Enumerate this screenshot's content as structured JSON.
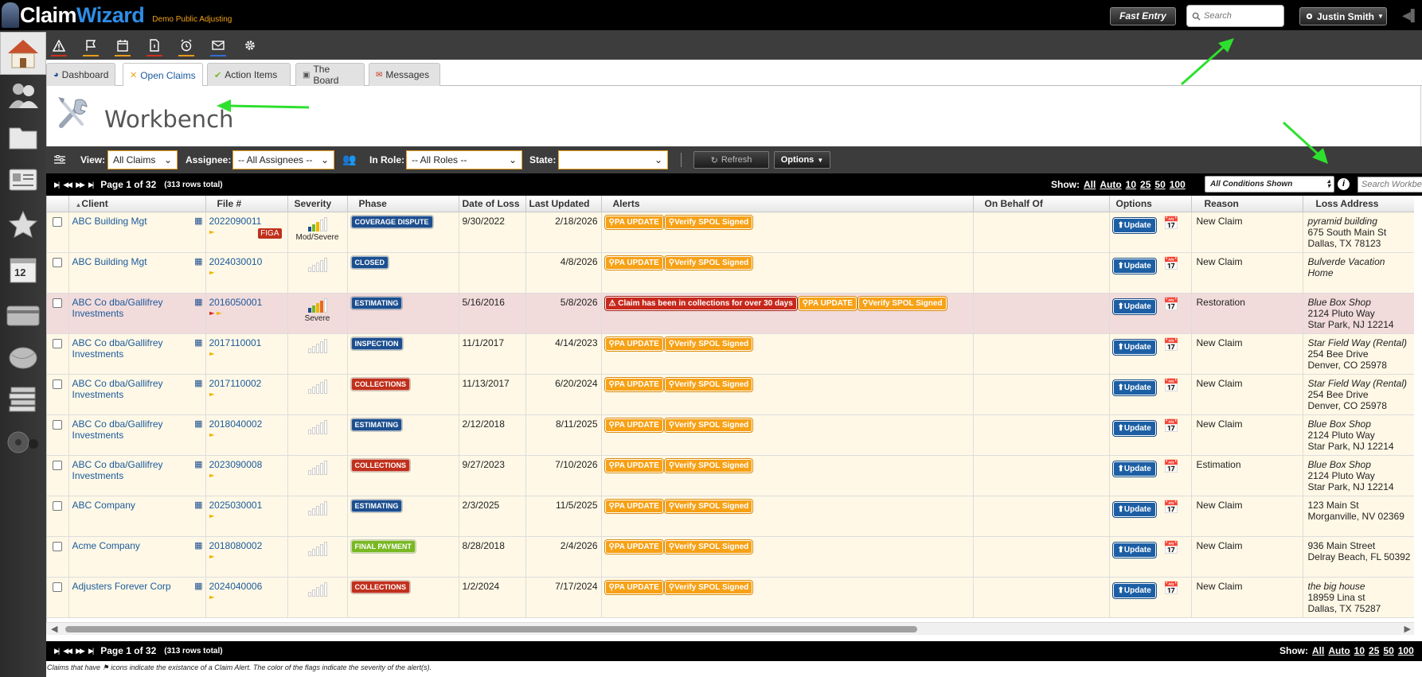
{
  "app": {
    "brand_part1": "Claim",
    "brand_part2": "Wizard",
    "company": "Demo Public Adjusting"
  },
  "header": {
    "fast_entry": "Fast Entry",
    "search_placeholder": "Search",
    "user": "Justin Smith"
  },
  "toolbar_icons": [
    "alert-triangle-icon",
    "flag-icon",
    "calendar-icon",
    "document-icon",
    "alarm-clock-icon",
    "mail-icon",
    "gear-icon"
  ],
  "tabs": [
    {
      "label": "Dashboard",
      "icon": "dashboard-icon"
    },
    {
      "label": "Open Claims",
      "icon": "tools-icon",
      "active": true
    },
    {
      "label": "Action Items",
      "icon": "checkmark-icon"
    },
    {
      "label": "The Board",
      "icon": "board-icon"
    },
    {
      "label": "Messages",
      "icon": "envelope-icon"
    }
  ],
  "page_title": "Workbench",
  "filters": {
    "view_label": "View:",
    "view_value": "All Claims",
    "assignee_label": "Assignee:",
    "assignee_value": "-- All Assignees --",
    "role_label": "In Role:",
    "role_value": "-- All Roles --",
    "state_label": "State:",
    "state_value": "",
    "refresh": "Refresh",
    "options": "Options"
  },
  "pager": {
    "page_text": "Page 1 of 32",
    "rows_text": "(313 rows total)",
    "show_label": "Show:",
    "show_options": [
      "All",
      "Auto",
      "10",
      "25",
      "50",
      "100"
    ],
    "conditions": "All Conditions Shown",
    "search_placeholder": "Search Workbench"
  },
  "columns": {
    "client": "Client",
    "file": "File #",
    "severity": "Severity",
    "phase": "Phase",
    "date_of_loss": "Date of Loss",
    "last_updated": "Last Updated",
    "alerts": "Alerts",
    "on_behalf_of": "On Behalf Of",
    "options": "Options",
    "reason": "Reason",
    "loss_address": "Loss Address"
  },
  "rows": [
    {
      "client": "ABC Building Mgt",
      "file": "2022090011",
      "figa": "FIGA",
      "severity_level": 3,
      "severity_label": "Mod/Severe",
      "phase": "COVERAGE DISPUTE",
      "phase_color": "blue",
      "dol": "9/30/2022",
      "updated": "2/18/2026",
      "alerts": [
        "PA UPDATE",
        "Verify SPOL Signed"
      ],
      "update": "Update",
      "reason": "New Claim",
      "addr": [
        "pyramid building",
        "675 South Main St",
        "Dallas, TX 78123"
      ],
      "flags": [
        "#f0b400"
      ]
    },
    {
      "client": "ABC Building Mgt",
      "file": "2024030010",
      "severity_level": 0,
      "severity_label": "",
      "phase": "CLOSED",
      "phase_color": "blue",
      "dol": "",
      "updated": "4/8/2026",
      "alerts": [
        "PA UPDATE",
        "Verify SPOL Signed"
      ],
      "update": "Update",
      "reason": "New Claim",
      "addr": [
        "Bulverde Vacation Home"
      ],
      "flags": [
        "#f0b400"
      ]
    },
    {
      "client": "ABC Co dba/Gallifrey Investments",
      "file": "2016050001",
      "severity_level": 4,
      "severity_label": "Severe",
      "phase": "ESTIMATING",
      "phase_color": "blue",
      "dol": "5/16/2016",
      "updated": "5/8/2026",
      "alert_red": "Claim has been in collections for over 30 days",
      "alerts": [
        "PA UPDATE",
        "Verify SPOL Signed"
      ],
      "update": "Update",
      "reason": "Restoration",
      "addr": [
        "Blue Box Shop",
        "2124 Pluto Way",
        "Star Park, NJ 12214"
      ],
      "flags": [
        "#d0301c",
        "#f0b400"
      ],
      "highlight": true
    },
    {
      "client": "ABC Co dba/Gallifrey Investments",
      "file": "2017110001",
      "severity_level": 0,
      "severity_label": "",
      "phase": "INSPECTION",
      "phase_color": "blue",
      "dol": "11/1/2017",
      "updated": "4/14/2023",
      "alerts": [
        "PA UPDATE",
        "Verify SPOL Signed"
      ],
      "update": "Update",
      "reason": "New Claim",
      "addr": [
        "Star Field Way (Rental)",
        "254 Bee Drive",
        "Denver, CO 25978"
      ],
      "flags": [
        "#f0b400"
      ]
    },
    {
      "client": "ABC Co dba/Gallifrey Investments",
      "file": "2017110002",
      "severity_level": 0,
      "severity_label": "",
      "phase": "COLLECTIONS",
      "phase_color": "red",
      "dol": "11/13/2017",
      "updated": "6/20/2024",
      "alerts": [
        "PA UPDATE",
        "Verify SPOL Signed"
      ],
      "update": "Update",
      "reason": "New Claim",
      "addr": [
        "Star Field Way (Rental)",
        "254 Bee Drive",
        "Denver, CO 25978"
      ],
      "flags": [
        "#f0b400"
      ]
    },
    {
      "client": "ABC Co dba/Gallifrey Investments",
      "file": "2018040002",
      "severity_level": 0,
      "severity_label": "",
      "phase": "ESTIMATING",
      "phase_color": "blue",
      "dol": "2/12/2018",
      "updated": "8/11/2025",
      "alerts": [
        "PA UPDATE",
        "Verify SPOL Signed"
      ],
      "update": "Update",
      "reason": "New Claim",
      "addr": [
        "Blue Box Shop",
        "2124 Pluto Way",
        "Star Park, NJ 12214"
      ],
      "flags": [
        "#f0b400"
      ]
    },
    {
      "client": "ABC Co dba/Gallifrey Investments",
      "file": "2023090008",
      "severity_level": 0,
      "severity_label": "",
      "phase": "COLLECTIONS",
      "phase_color": "red",
      "dol": "9/27/2023",
      "updated": "7/10/2026",
      "alerts": [
        "PA UPDATE",
        "Verify SPOL Signed"
      ],
      "update": "Update",
      "reason": "Estimation",
      "addr": [
        "Blue Box Shop",
        "2124 Pluto Way",
        "Star Park, NJ 12214"
      ],
      "flags": [
        "#f0b400"
      ]
    },
    {
      "client": "ABC Company",
      "file": "2025030001",
      "severity_level": 0,
      "severity_label": "",
      "phase": "ESTIMATING",
      "phase_color": "blue",
      "dol": "2/3/2025",
      "updated": "11/5/2025",
      "alerts": [
        "PA UPDATE",
        "Verify SPOL Signed"
      ],
      "update": "Update",
      "reason": "New Claim",
      "addr": [
        "",
        "123 Main St",
        "Morganville, NV 02369"
      ],
      "flags": [
        "#f0b400"
      ]
    },
    {
      "client": "Acme Company",
      "file": "2018080002",
      "severity_level": 0,
      "severity_label": "",
      "phase": "FINAL PAYMENT",
      "phase_color": "green",
      "dol": "8/28/2018",
      "updated": "2/4/2026",
      "alerts": [
        "PA UPDATE",
        "Verify SPOL Signed"
      ],
      "update": "Update",
      "reason": "New Claim",
      "addr": [
        "",
        "936 Main Street",
        "Delray Beach, FL 50392"
      ],
      "flags": [
        "#f0b400"
      ]
    },
    {
      "client": "Adjusters Forever Corp",
      "file": "2024040006",
      "severity_level": 0,
      "severity_label": "",
      "phase": "COLLECTIONS",
      "phase_color": "red",
      "dol": "1/2/2024",
      "updated": "7/17/2024",
      "alerts": [
        "PA UPDATE",
        "Verify SPOL Signed"
      ],
      "update": "Update",
      "reason": "New Claim",
      "addr": [
        "the big house",
        "18959 Lina st",
        "Dallas, TX 75287"
      ],
      "flags": [
        "#f0b400"
      ]
    }
  ],
  "footnote_pre": "Claims that have",
  "footnote_post": "icons indicate the existance of a Claim Alert. The color of the flags indicate the severity of the alert(s)."
}
